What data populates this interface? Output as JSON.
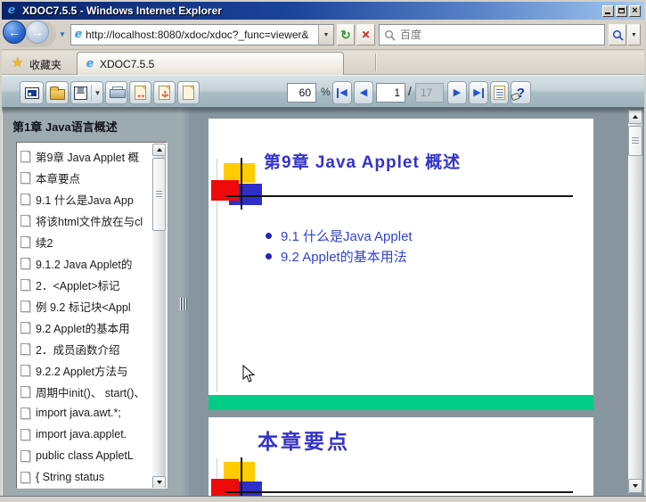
{
  "window": {
    "title": "XDOC7.5.5 - Windows Internet Explorer",
    "close_glyph": "×"
  },
  "nav": {
    "url": "http://localhost:8080/xdoc/xdoc?_func=viewer&",
    "search_placeholder": "百度"
  },
  "favorites": {
    "label": "收藏夹",
    "tab_title": "XDOC7.5.5"
  },
  "toolbar": {
    "zoom_value": "60",
    "percent_label": "%",
    "page_current": "1",
    "page_separator": "/",
    "page_total": "17"
  },
  "sidebar": {
    "header": "第1章  Java语言概述",
    "items": [
      "第9章  Java Applet 概",
      "本章要点",
      "9.1  什么是Java App",
      "将该html文件放在与cl",
      "续2",
      "9.1.2 Java Applet的",
      "2．<Applet>标记",
      "例 9.2  标记块<Appl",
      "9.2  Applet的基本用",
      "2．成员函数介绍",
      "9.2.2  Applet方法与",
      "周期中init()、 start()、",
      "import java.awt.*;",
      "import java.applet.",
      "public class AppletL",
      "{      String status"
    ]
  },
  "slides": {
    "slide1": {
      "title": "第9章  Java Applet 概述",
      "bullets": [
        "9.1 什么是Java Applet",
        "9.2 Applet的基本用法"
      ]
    },
    "slide2": {
      "title": "本章要点"
    }
  },
  "icons": {
    "ie_logo": "e",
    "back": "←",
    "forward": "→",
    "url_dropdown": "▼",
    "refresh": "↻",
    "stop": "✕",
    "search_dropdown": "▼",
    "favorites_star": "★",
    "save_dropdown": "▾",
    "fit_width_arrow": "↔",
    "fit_height_arrow": "↕",
    "prev_arrow": "◀",
    "next_arrow": "▶",
    "help_mark": "?"
  },
  "colors": {
    "titlebar_gradient_left": "#0a246a",
    "titlebar_gradient_right": "#a6caf0",
    "toolbar_button_blue": "#2a52c8",
    "slide_text_blue": "#3533c8",
    "green_bar": "#00cc88",
    "square_yellow": "#ffcc00",
    "square_red": "#ee0a0a",
    "square_blue": "#2f2fc8",
    "viewer_background": "#8b9aa2"
  }
}
